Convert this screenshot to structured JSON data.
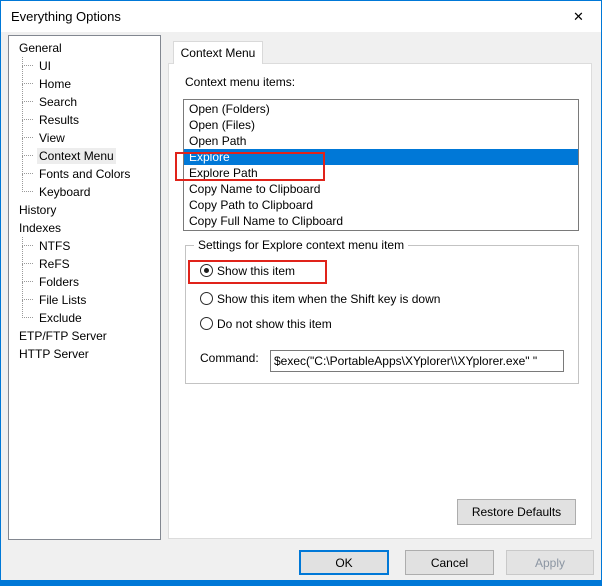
{
  "window": {
    "title": "Everything Options",
    "close_icon": "✕"
  },
  "sidebar": {
    "items": [
      {
        "label": "General"
      },
      {
        "label": "UI"
      },
      {
        "label": "Home"
      },
      {
        "label": "Search"
      },
      {
        "label": "Results"
      },
      {
        "label": "View"
      },
      {
        "label": "Context Menu"
      },
      {
        "label": "Fonts and Colors"
      },
      {
        "label": "Keyboard"
      },
      {
        "label": "History"
      },
      {
        "label": "Indexes"
      },
      {
        "label": "NTFS"
      },
      {
        "label": "ReFS"
      },
      {
        "label": "Folders"
      },
      {
        "label": "File Lists"
      },
      {
        "label": "Exclude"
      },
      {
        "label": "ETP/FTP Server"
      },
      {
        "label": "HTTP Server"
      }
    ]
  },
  "tabs": {
    "active_label": "Context Menu"
  },
  "content": {
    "list_label": "Context menu items:",
    "list_items": [
      {
        "label": "Open (Folders)"
      },
      {
        "label": "Open (Files)"
      },
      {
        "label": "Open Path"
      },
      {
        "label": "Explore"
      },
      {
        "label": "Explore Path"
      },
      {
        "label": "Copy Name to Clipboard"
      },
      {
        "label": "Copy Path to Clipboard"
      },
      {
        "label": "Copy Full Name to Clipboard"
      }
    ],
    "selected_list_item": "Explore",
    "group_title": "Settings for Explore context menu item",
    "radios": [
      {
        "label": "Show this item",
        "checked": true
      },
      {
        "label": "Show this item when the Shift key is down",
        "checked": false
      },
      {
        "label": "Do not show this item",
        "checked": false
      }
    ],
    "command_label": "Command:",
    "command_value": "$exec(\"C:\\PortableApps\\XYplorer\\\\XYplorer.exe\" \"",
    "restore_defaults_label": "Restore Defaults"
  },
  "footer": {
    "ok_label": "OK",
    "cancel_label": "Cancel",
    "apply_label": "Apply"
  },
  "colors": {
    "selection_blue": "#0078d7",
    "window_border_blue": "#0078d7",
    "annotation_red": "#e0231a"
  }
}
